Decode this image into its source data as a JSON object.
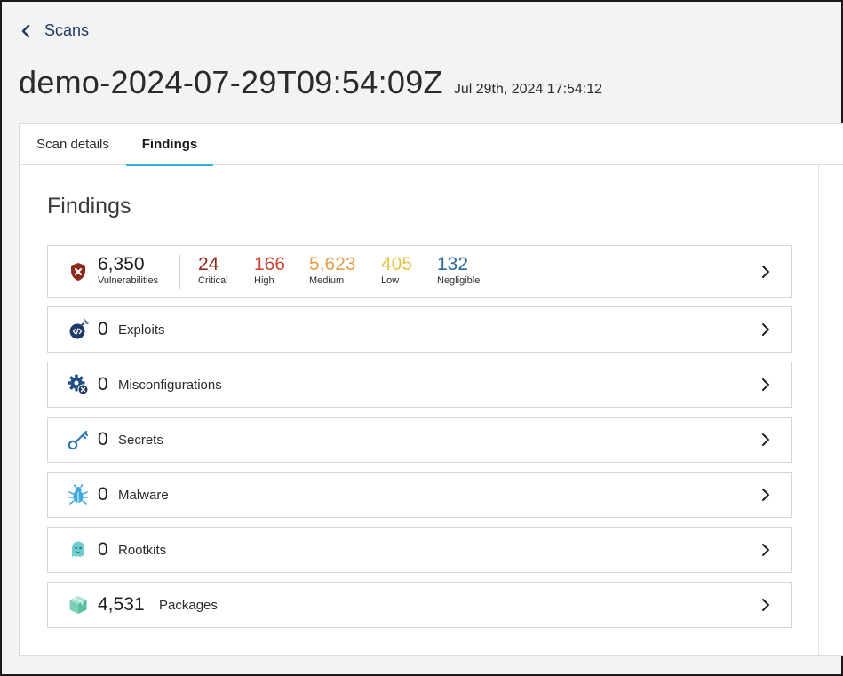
{
  "nav": {
    "back_label": "Scans"
  },
  "header": {
    "title": "demo-2024-07-29T09:54:09Z",
    "timestamp": "Jul 29th, 2024 17:54:12"
  },
  "tabs": [
    {
      "label": "Scan details",
      "active": false
    },
    {
      "label": "Findings",
      "active": true
    }
  ],
  "section": {
    "title": "Findings"
  },
  "vulnerabilities": {
    "total": "6,350",
    "total_label": "Vulnerabilities",
    "severities": [
      {
        "value": "24",
        "label": "Critical",
        "color": "#8c2a1c"
      },
      {
        "value": "166",
        "label": "High",
        "color": "#c94a3b"
      },
      {
        "value": "5,623",
        "label": "Medium",
        "color": "#e3a04a"
      },
      {
        "value": "405",
        "label": "Low",
        "color": "#e3c24a"
      },
      {
        "value": "132",
        "label": "Negligible",
        "color": "#2d6a9a"
      }
    ]
  },
  "findings": [
    {
      "count": "0",
      "label": "Exploits",
      "icon": "exploit-bomb-icon"
    },
    {
      "count": "0",
      "label": "Misconfigurations",
      "icon": "gear-x-icon"
    },
    {
      "count": "0",
      "label": "Secrets",
      "icon": "key-icon"
    },
    {
      "count": "0",
      "label": "Malware",
      "icon": "bug-icon"
    },
    {
      "count": "0",
      "label": "Rootkits",
      "icon": "ghost-icon"
    },
    {
      "count": "4,531",
      "label": "Packages",
      "icon": "package-icon"
    }
  ],
  "colors": {
    "accent": "#2fb3d8",
    "nav_text": "#1f3a66",
    "vuln_shield": "#8c2a1c"
  }
}
